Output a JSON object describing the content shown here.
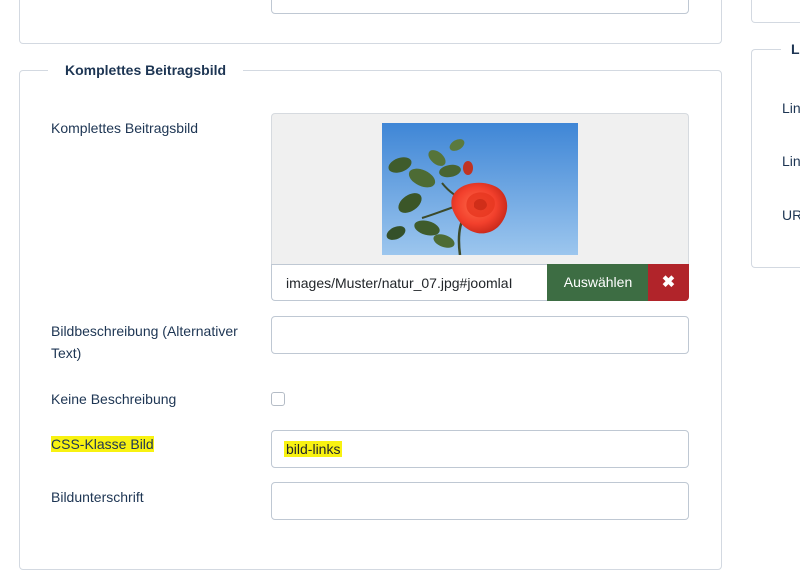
{
  "image_section": {
    "legend": "Komplettes Beitragsbild",
    "full_image_label": "Komplettes Beitragsbild",
    "image_path": "images/Muster/natur_07.jpg#joomlaI",
    "select_button": "Auswählen",
    "clear_button": "✖",
    "alt_text_label": "Bildbeschreibung (Alternativer Text)",
    "alt_text_value": "",
    "no_description_label": "Keine Beschreibung",
    "no_description_checked": false,
    "css_class_label": "CSS-Klasse Bild",
    "css_class_value": "bild-links",
    "caption_label": "Bildunterschrift",
    "caption_value": ""
  },
  "right_panel": {
    "legend": "L",
    "labels": [
      "Lin",
      "Lin",
      "UR"
    ]
  },
  "colors": {
    "select_button": "#3d6d43",
    "clear_button": "#b1242a",
    "highlight": "#f8f211",
    "label_text": "#1d3553"
  },
  "icons": {
    "clear": "close-icon"
  }
}
